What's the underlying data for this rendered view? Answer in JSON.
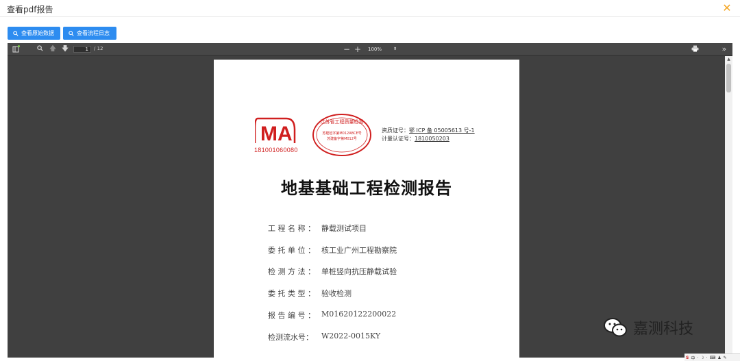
{
  "dialog": {
    "title": "查看pdf报告",
    "close_icon": "close-icon",
    "accent": "#f5a623"
  },
  "actions": [
    {
      "label": "查看原始数据",
      "icon": "search-icon"
    },
    {
      "label": "查看流程日志",
      "icon": "search-icon"
    }
  ],
  "pdf_toolbar": {
    "sidebar_toggle_icon": "sidebar-toggle-icon",
    "find_icon": "search-icon",
    "prev_icon": "arrow-up-icon",
    "next_icon": "arrow-down-icon",
    "page_current": "1",
    "page_total": "/ 12",
    "zoom_out": "−",
    "zoom_in": "+",
    "zoom_level": "100%",
    "print_icon": "print-icon",
    "more_icon": "double-chevron-right-icon"
  },
  "document": {
    "ma_logo_text": "MA",
    "ma_number": "181001060080",
    "seal_text": "江苏省工程质量检测",
    "seal_lines": [
      "苏建检字第M012ABCE号",
      "苏建备字第M012号"
    ],
    "cert_lines": [
      {
        "label": "资质证号：",
        "value": "鄂 ICP 备 05005613 号-1"
      },
      {
        "label": "计量认证号：",
        "value": "1810050203"
      }
    ],
    "title": "地基基础工程检测报告",
    "fields": [
      {
        "label": "工 程 名 称 ：",
        "value": "静载测试项目"
      },
      {
        "label": "委 托 单 位 ：",
        "value": "核工业广州工程勘察院"
      },
      {
        "label": "检 测 方 法 ：",
        "value": "单桩竖向抗压静载试验"
      },
      {
        "label": "委 托 类 型 ：",
        "value": "验收检测"
      },
      {
        "label": "报 告 编 号 ：",
        "value": "M01620122200022"
      },
      {
        "label": "检测流水号：",
        "value": "W2022-0015KY"
      }
    ]
  },
  "watermark": {
    "text": "嘉测科技",
    "icon": "wechat-icon"
  },
  "ime": {
    "items": [
      "S",
      "中",
      "·",
      "☽",
      "·",
      "⌨",
      "♟",
      "✎"
    ]
  },
  "colors": {
    "button_blue": "#2d8cf0",
    "viewer_bg": "#404040",
    "stamp_red": "#d01f1f"
  }
}
